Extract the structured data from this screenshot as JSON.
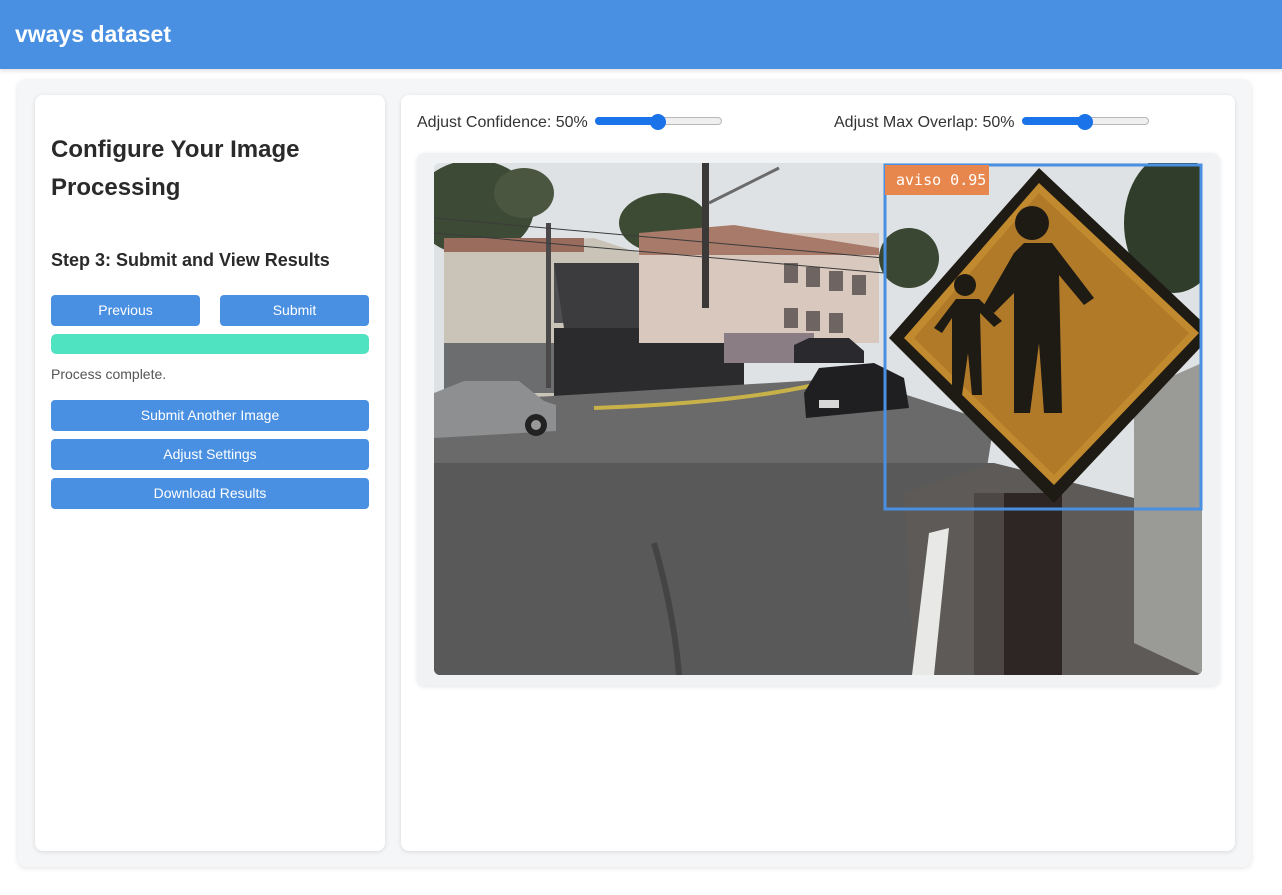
{
  "header": {
    "title": "vways dataset"
  },
  "sidebar": {
    "heading": "Configure Your Image Processing",
    "step_title": "Step 3: Submit and View Results",
    "previous_label": "Previous",
    "submit_label": "Submit",
    "progress_percent": 100,
    "status": "Process complete.",
    "submit_another_label": "Submit Another Image",
    "adjust_settings_label": "Adjust Settings",
    "download_label": "Download Results"
  },
  "controls": {
    "confidence_label": "Adjust Confidence: 50%",
    "confidence_value": 50,
    "overlap_label": "Adjust Max Overlap: 50%",
    "overlap_value": 50
  },
  "detection": {
    "label": "aviso 0.95",
    "class": "aviso",
    "confidence": 0.95,
    "box_color": "#4a90e2",
    "label_color": "#e8874d"
  },
  "colors": {
    "primary": "#4a90e2",
    "progress": "#50e3c2",
    "slider": "#1a73e8"
  }
}
